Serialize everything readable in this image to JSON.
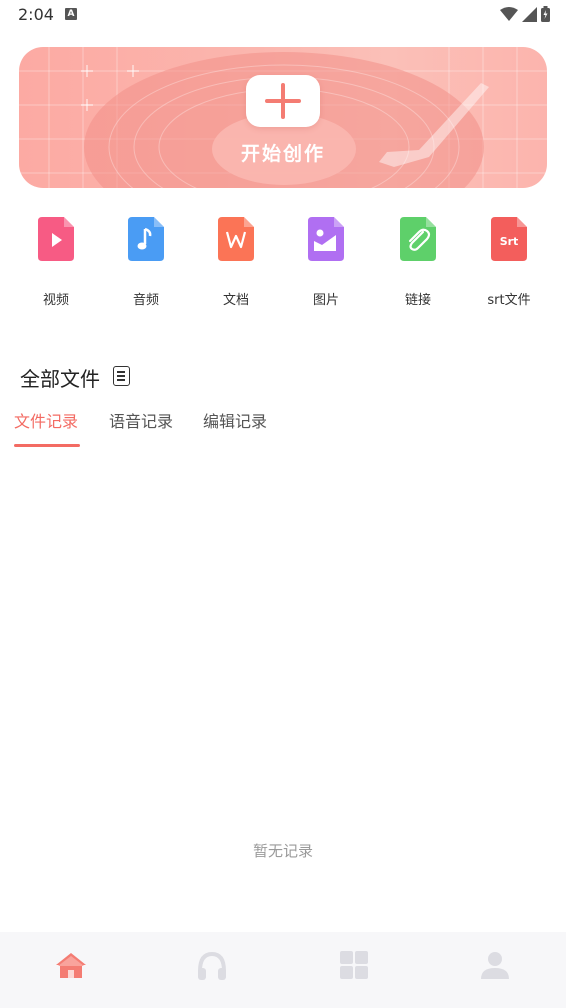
{
  "status_bar": {
    "time": "2:04",
    "notification_badge": "A"
  },
  "banner": {
    "create_label": "开始创作"
  },
  "tools": [
    {
      "label": "视频",
      "icon": "video-file-icon",
      "color": "#f75b84"
    },
    {
      "label": "音频",
      "icon": "audio-file-icon",
      "color": "#4a9cf4"
    },
    {
      "label": "文档",
      "icon": "document-file-icon",
      "color": "#fb7456",
      "glyph": "W"
    },
    {
      "label": "图片",
      "icon": "image-file-icon",
      "color": "#b06ff2"
    },
    {
      "label": "链接",
      "icon": "link-file-icon",
      "color": "#5ed06a"
    },
    {
      "label": "srt文件",
      "icon": "srt-file-icon",
      "color": "#f35e5c",
      "glyph": "Srt"
    }
  ],
  "section": {
    "title": "全部文件"
  },
  "tabs": [
    {
      "label": "文件记录",
      "active": true
    },
    {
      "label": "语音记录",
      "active": false
    },
    {
      "label": "编辑记录",
      "active": false
    }
  ],
  "empty_state": "暂无记录",
  "bottom_nav": [
    {
      "icon": "home-icon",
      "active": true
    },
    {
      "icon": "headphones-icon",
      "active": false
    },
    {
      "icon": "grid-icon",
      "active": false
    },
    {
      "icon": "profile-icon",
      "active": false
    }
  ],
  "colors": {
    "accent": "#f36b63",
    "banner": "#fbb6ae",
    "inactive_nav": "#dcdce2"
  }
}
